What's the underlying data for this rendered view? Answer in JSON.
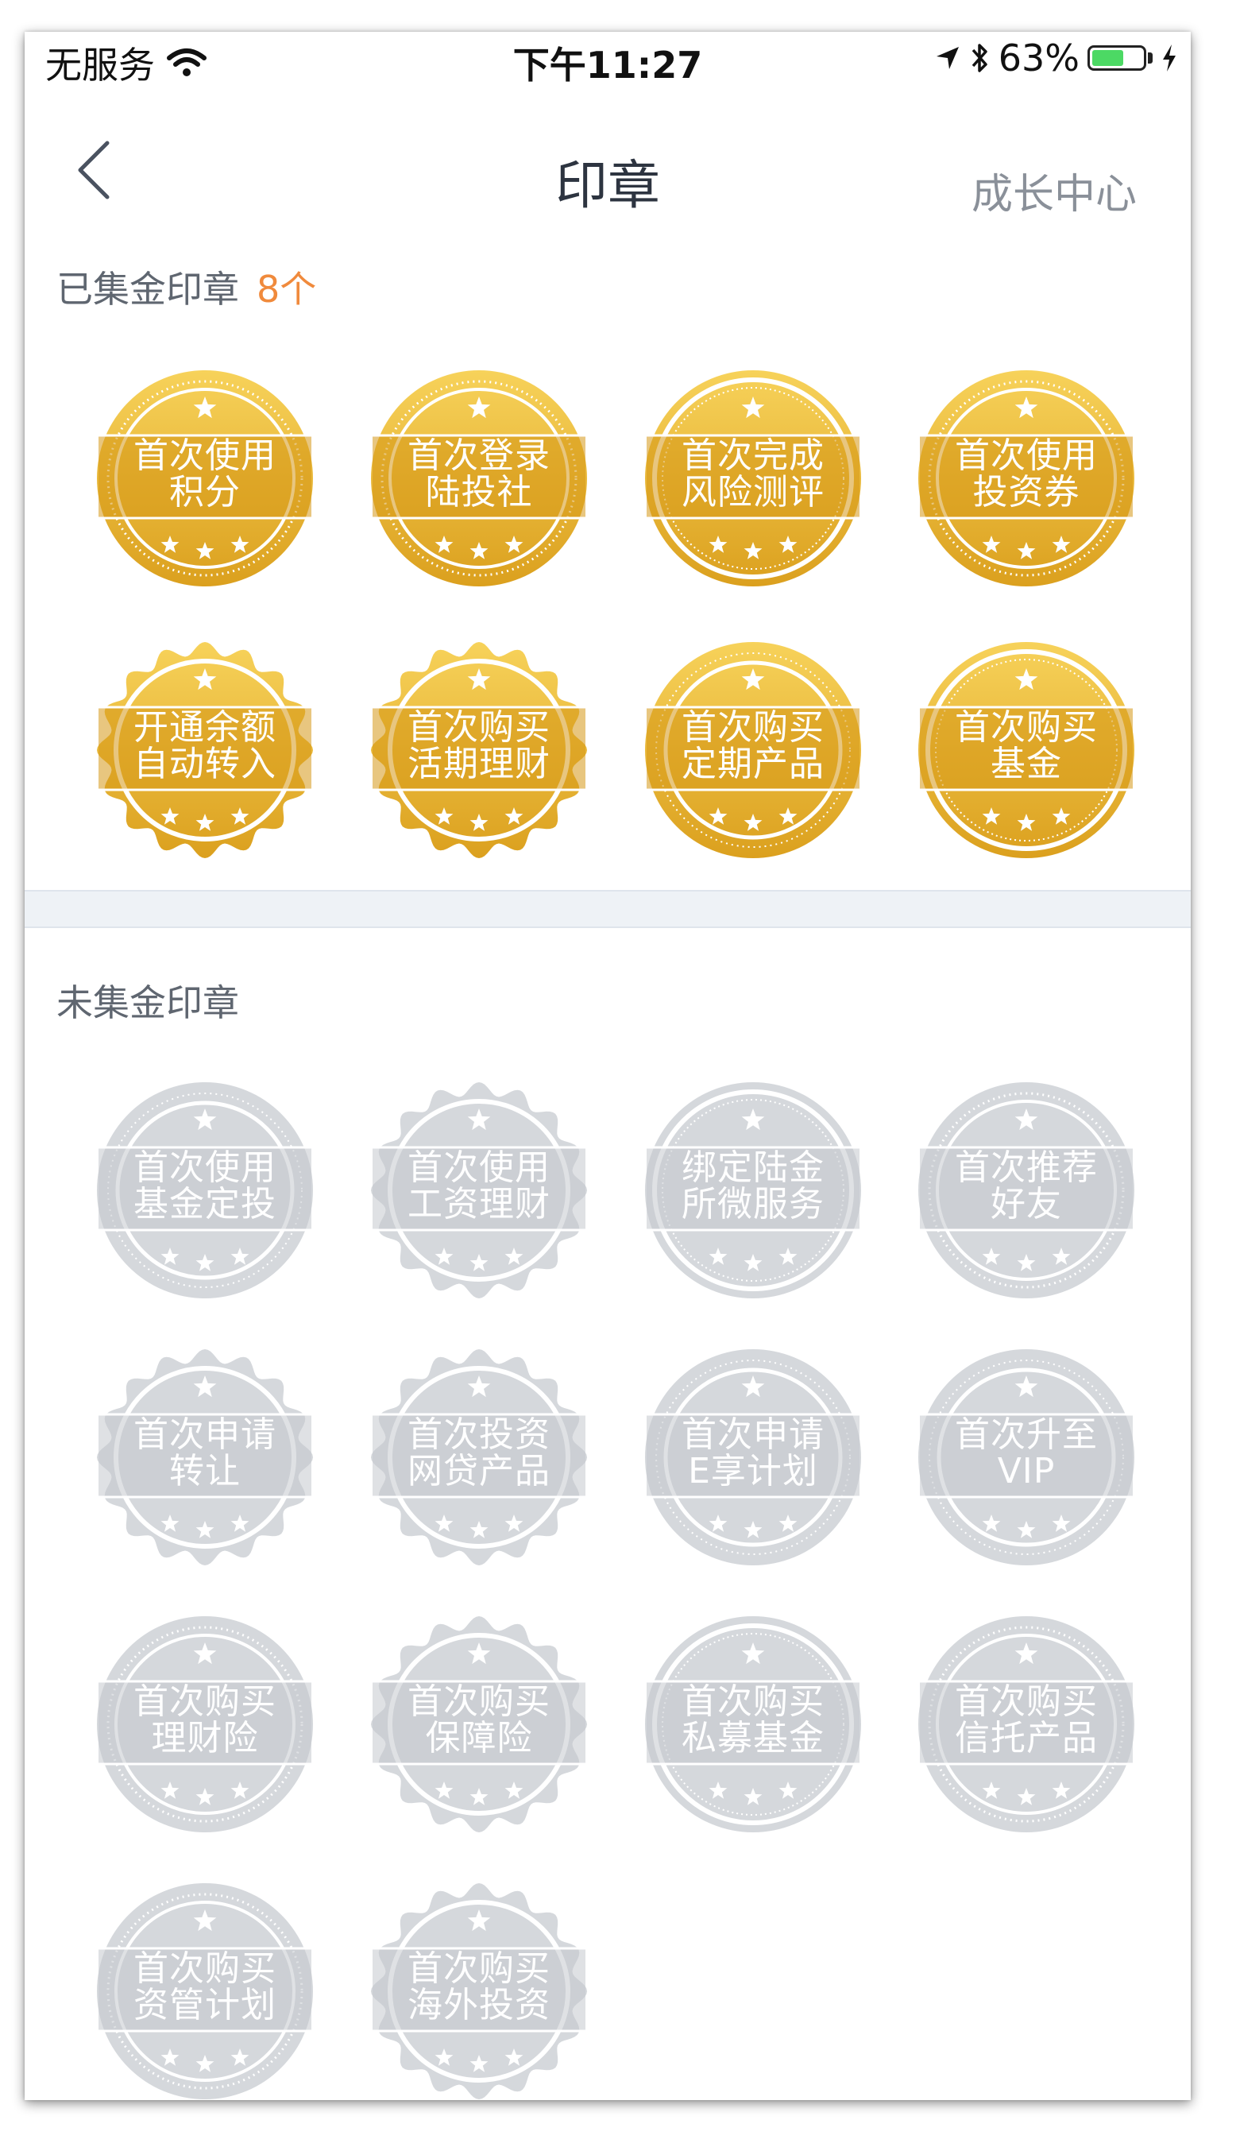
{
  "status_bar": {
    "carrier": "无服务",
    "time": "下午11:27",
    "battery_pct": "63%",
    "battery_level": 0.63
  },
  "nav": {
    "title": "印章",
    "right_link": "成长中心"
  },
  "collected": {
    "title": "已集金印章",
    "count": "8个",
    "stamps": [
      {
        "line1": "首次使用",
        "line2": "积分"
      },
      {
        "line1": "首次登录",
        "line2": "陆投社"
      },
      {
        "line1": "首次完成",
        "line2": "风险测评"
      },
      {
        "line1": "首次使用",
        "line2": "投资券"
      },
      {
        "line1": "开通余额",
        "line2": "自动转入"
      },
      {
        "line1": "首次购买",
        "line2": "活期理财"
      },
      {
        "line1": "首次购买",
        "line2": "定期产品"
      },
      {
        "line1": "首次购买",
        "line2": "基金"
      }
    ]
  },
  "uncollected": {
    "title": "未集金印章",
    "stamps": [
      {
        "line1": "首次使用",
        "line2": "基金定投"
      },
      {
        "line1": "首次使用",
        "line2": "工资理财"
      },
      {
        "line1": "绑定陆金",
        "line2": "所微服务"
      },
      {
        "line1": "首次推荐",
        "line2": "好友"
      },
      {
        "line1": "首次申请",
        "line2": "转让"
      },
      {
        "line1": "首次投资",
        "line2": "网贷产品"
      },
      {
        "line1": "首次申请",
        "line2": "E享计划"
      },
      {
        "line1": "首次升至",
        "line2": "VIP"
      },
      {
        "line1": "首次购买",
        "line2": "理财险"
      },
      {
        "line1": "首次购买",
        "line2": "保障险"
      },
      {
        "line1": "首次购买",
        "line2": "私募基金"
      },
      {
        "line1": "首次购买",
        "line2": "信托产品"
      },
      {
        "line1": "首次购买",
        "line2": "资管计划"
      },
      {
        "line1": "首次购买",
        "line2": "海外投资"
      }
    ]
  },
  "colors": {
    "gold_light": "#f7d25a",
    "gold_dark": "#dba01e",
    "gold_band": "#d69716",
    "gray_body": "#d5d8dc",
    "gray_band": "#c4c8cd",
    "accent_orange": "#f08a3c",
    "battery_green": "#4cd964"
  }
}
